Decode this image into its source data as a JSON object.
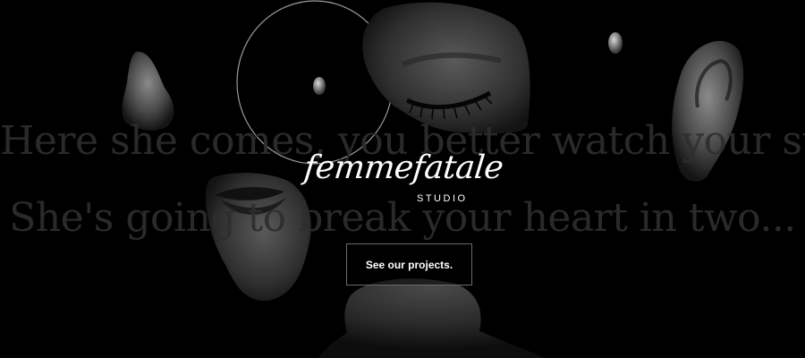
{
  "hero": {
    "lyric_line_1": "Here she comes, you better watch your step",
    "lyric_line_2": "She's going to break your heart in two...",
    "logo_wordmark": "femmefatale",
    "logo_subtitle": "STUDIO",
    "cta_label": "See our projects."
  },
  "colors": {
    "background": "#000000",
    "lyric_text": "#2e2e2e",
    "logo_text": "#ffffff",
    "cta_border": "#6a6a6a"
  },
  "imagery": [
    "nose-fragment",
    "eye-fragment",
    "ear-fragment",
    "lips-fragment",
    "neck-fragment",
    "pearl-earring",
    "black-circle"
  ]
}
